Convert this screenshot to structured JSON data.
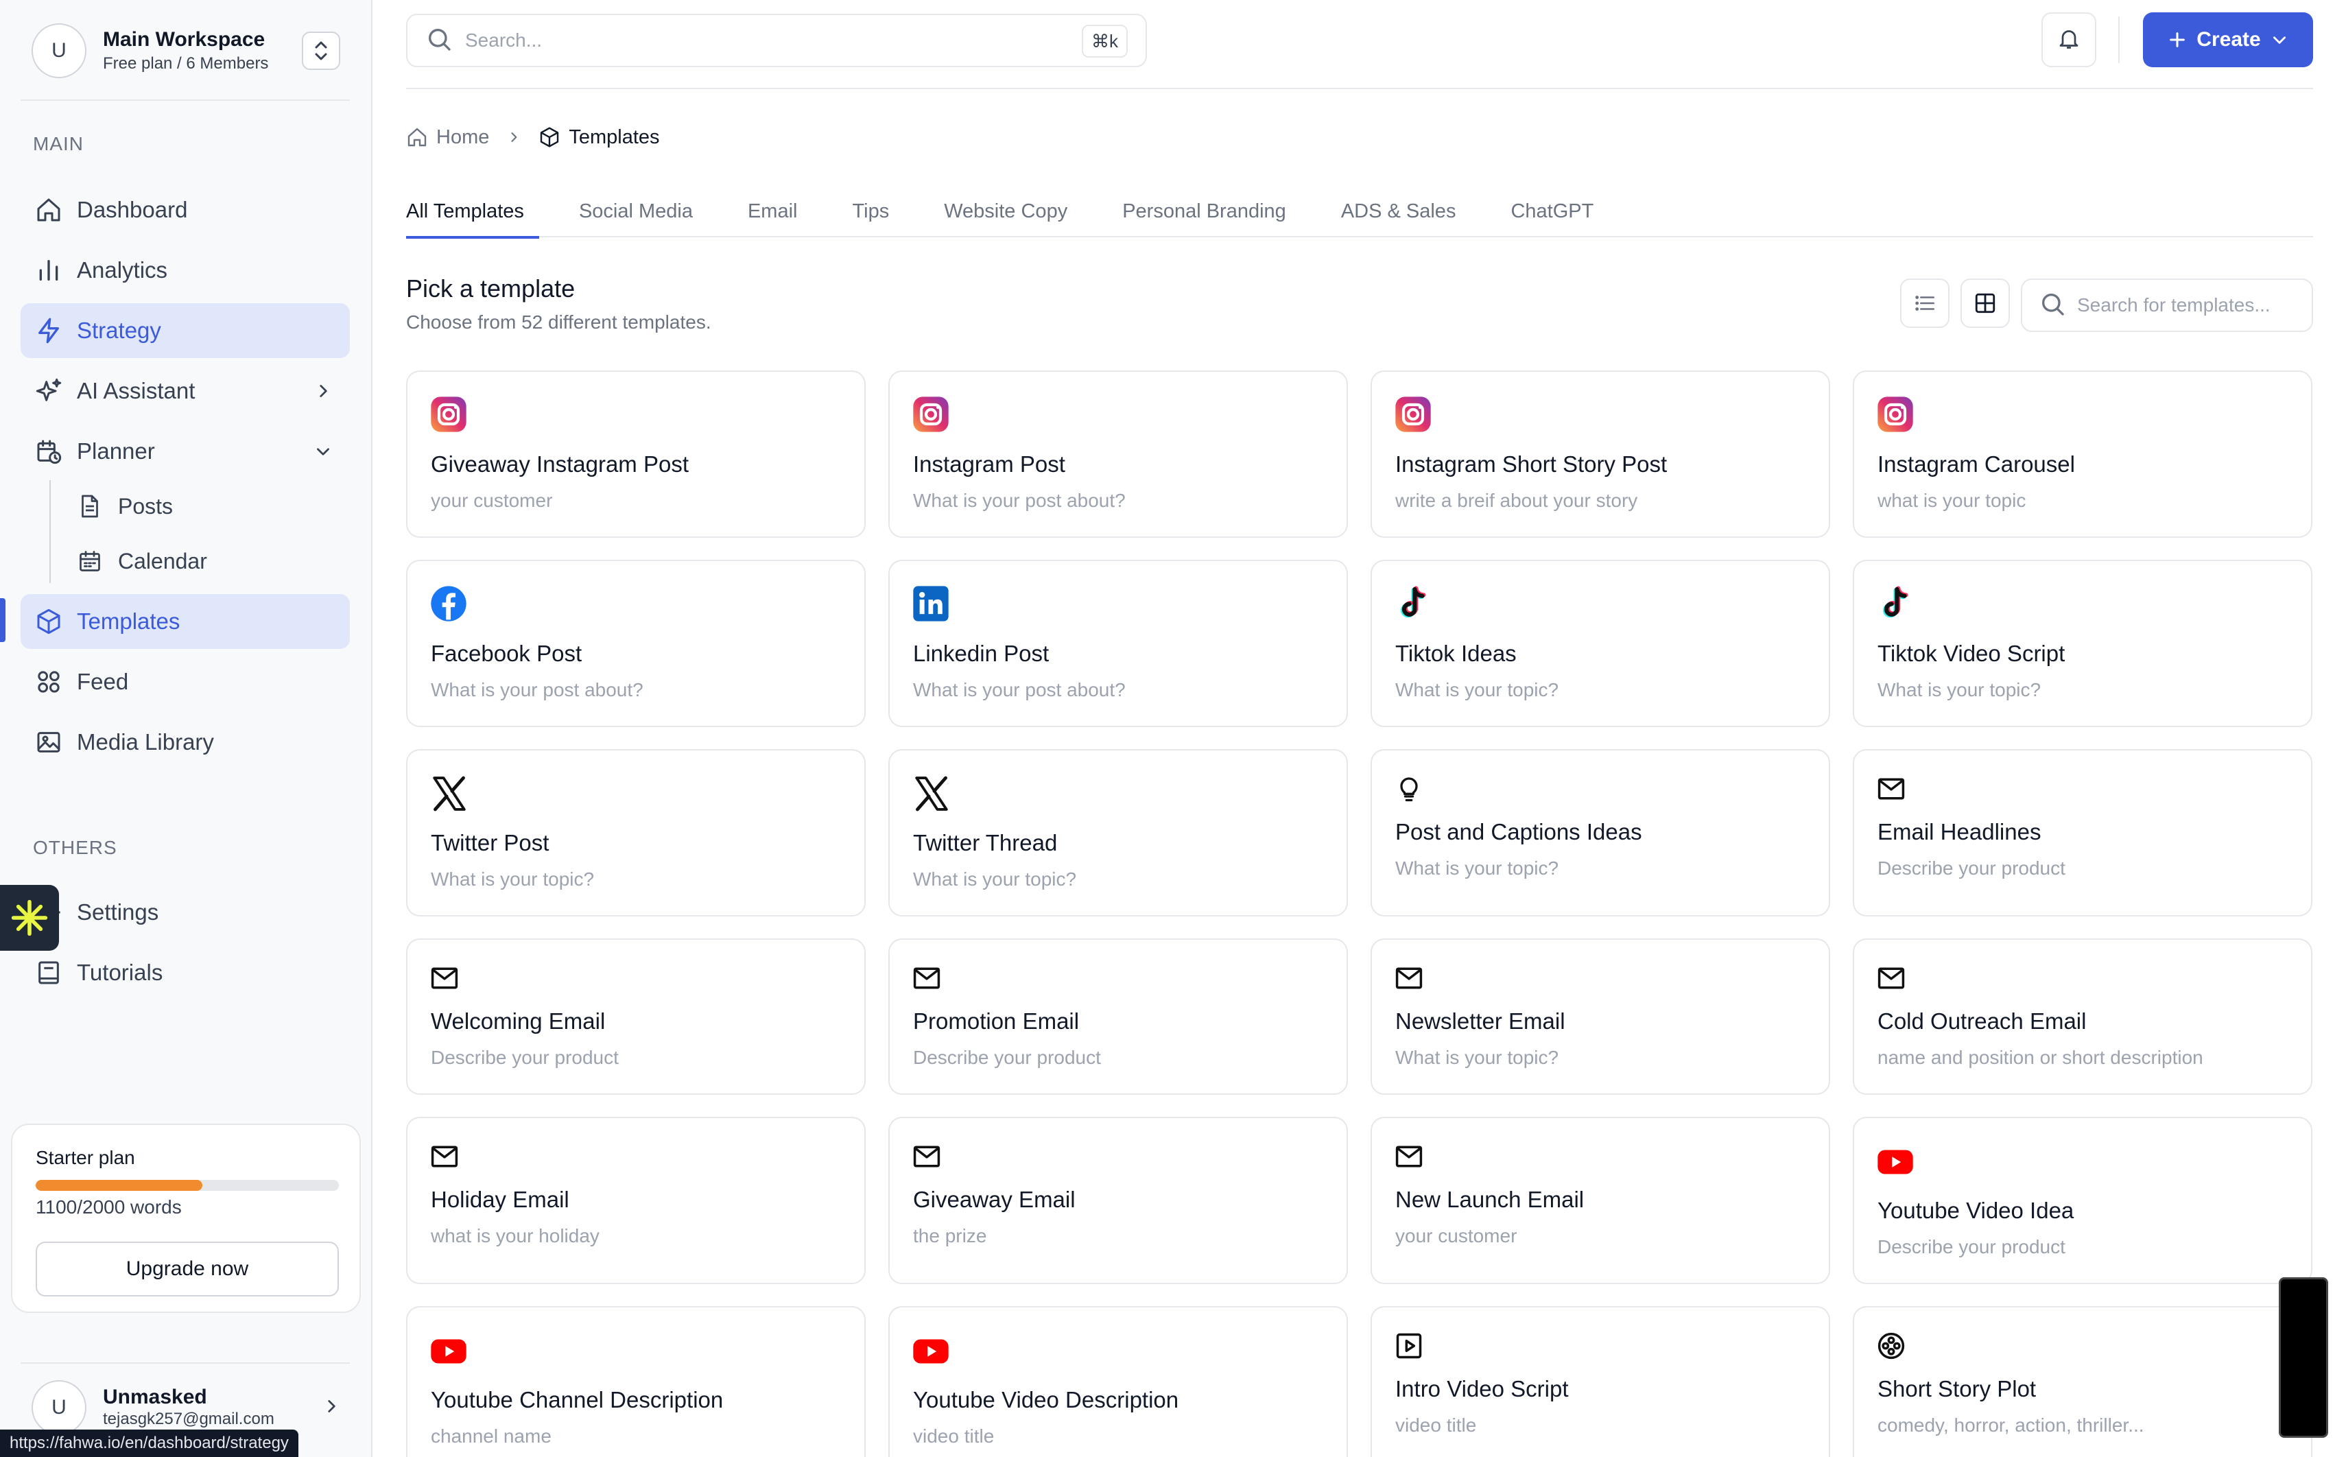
{
  "workspace": {
    "avatar_initial": "U",
    "name": "Main Workspace",
    "subtitle": "Free plan / 6 Members"
  },
  "sidebar": {
    "main_label": "MAIN",
    "items": [
      {
        "label": "Dashboard",
        "icon": "home-icon"
      },
      {
        "label": "Analytics",
        "icon": "bar-chart-icon"
      },
      {
        "label": "Strategy",
        "icon": "lightning-icon",
        "active": true
      },
      {
        "label": "AI Assistant",
        "icon": "sparkles-icon"
      },
      {
        "label": "Planner",
        "icon": "calendar-clock-icon"
      },
      {
        "label": "Posts",
        "icon": "document-icon"
      },
      {
        "label": "Calendar",
        "icon": "calendar-icon"
      },
      {
        "label": "Templates",
        "icon": "cube-icon",
        "selected": true
      },
      {
        "label": "Feed",
        "icon": "grid-circles-icon"
      },
      {
        "label": "Media Library",
        "icon": "image-icon"
      }
    ],
    "others_label": "OTHERS",
    "others": [
      {
        "label": "Settings",
        "icon": "gear-icon"
      },
      {
        "label": "Tutorials",
        "icon": "book-icon"
      }
    ]
  },
  "plan": {
    "title": "Starter plan",
    "words": "1100/2000 words",
    "progress": 0.55,
    "upgrade_label": "Upgrade now"
  },
  "user": {
    "avatar_initial": "U",
    "name": "Unmasked",
    "email": "tejasgk257@gmail.com"
  },
  "status_url": "https://fahwa.io/en/dashboard/strategy",
  "topbar": {
    "search_placeholder": "Search...",
    "shortcut": "⌘k",
    "create_label": "Create"
  },
  "breadcrumb": {
    "home": "Home",
    "current": "Templates"
  },
  "tabs": [
    "All Templates",
    "Social Media",
    "Email",
    "Tips",
    "Website Copy",
    "Personal Branding",
    "ADS & Sales",
    "ChatGPT"
  ],
  "header": {
    "title": "Pick a template",
    "subtitle": "Choose from 52 different templates.",
    "search_placeholder": "Search for templates..."
  },
  "templates": [
    {
      "title": "Giveaway Instagram Post",
      "subtitle": "your customer",
      "icon": "instagram-icon"
    },
    {
      "title": "Instagram Post",
      "subtitle": "What is your post about?",
      "icon": "instagram-icon"
    },
    {
      "title": "Instagram Short Story Post",
      "subtitle": "write a breif about your story",
      "icon": "instagram-icon"
    },
    {
      "title": "Instagram Carousel",
      "subtitle": "what is your topic",
      "icon": "instagram-icon"
    },
    {
      "title": "Facebook Post",
      "subtitle": "What is your post about?",
      "icon": "facebook-icon"
    },
    {
      "title": "Linkedin Post",
      "subtitle": "What is your post about?",
      "icon": "linkedin-icon"
    },
    {
      "title": "Tiktok Ideas",
      "subtitle": "What is your topic?",
      "icon": "tiktok-icon"
    },
    {
      "title": "Tiktok Video Script",
      "subtitle": "What is your topic?",
      "icon": "tiktok-icon"
    },
    {
      "title": "Twitter Post",
      "subtitle": "What is your topic?",
      "icon": "x-icon"
    },
    {
      "title": "Twitter Thread",
      "subtitle": "What is your topic?",
      "icon": "x-icon"
    },
    {
      "title": "Post and Captions Ideas",
      "subtitle": "What is your topic?",
      "icon": "lightbulb-icon"
    },
    {
      "title": "Email Headlines",
      "subtitle": "Describe your product",
      "icon": "mail-icon"
    },
    {
      "title": "Welcoming Email",
      "subtitle": "Describe your product",
      "icon": "mail-icon"
    },
    {
      "title": "Promotion Email",
      "subtitle": "Describe your product",
      "icon": "mail-icon"
    },
    {
      "title": "Newsletter Email",
      "subtitle": "What is your topic?",
      "icon": "mail-icon"
    },
    {
      "title": "Cold Outreach Email",
      "subtitle": "name and position or short description",
      "icon": "mail-icon"
    },
    {
      "title": "Holiday Email",
      "subtitle": "what is your holiday",
      "icon": "mail-icon"
    },
    {
      "title": "Giveaway Email",
      "subtitle": "the prize",
      "icon": "mail-icon"
    },
    {
      "title": "New Launch Email",
      "subtitle": "your customer",
      "icon": "mail-icon"
    },
    {
      "title": "Youtube Video Idea",
      "subtitle": "Describe your product",
      "icon": "youtube-icon"
    },
    {
      "title": "Youtube Channel Description",
      "subtitle": "channel name",
      "icon": "youtube-icon"
    },
    {
      "title": "Youtube Video Description",
      "subtitle": "video title",
      "icon": "youtube-icon"
    },
    {
      "title": "Intro Video Script",
      "subtitle": "video title",
      "icon": "play-square-icon"
    },
    {
      "title": "Short Story Plot",
      "subtitle": "comedy, horror, action, thriller...",
      "icon": "film-reel-icon"
    }
  ],
  "colors": {
    "accent": "#3b5bdb",
    "active_bg": "#e0e7fb",
    "progress": "#f08c2e"
  }
}
